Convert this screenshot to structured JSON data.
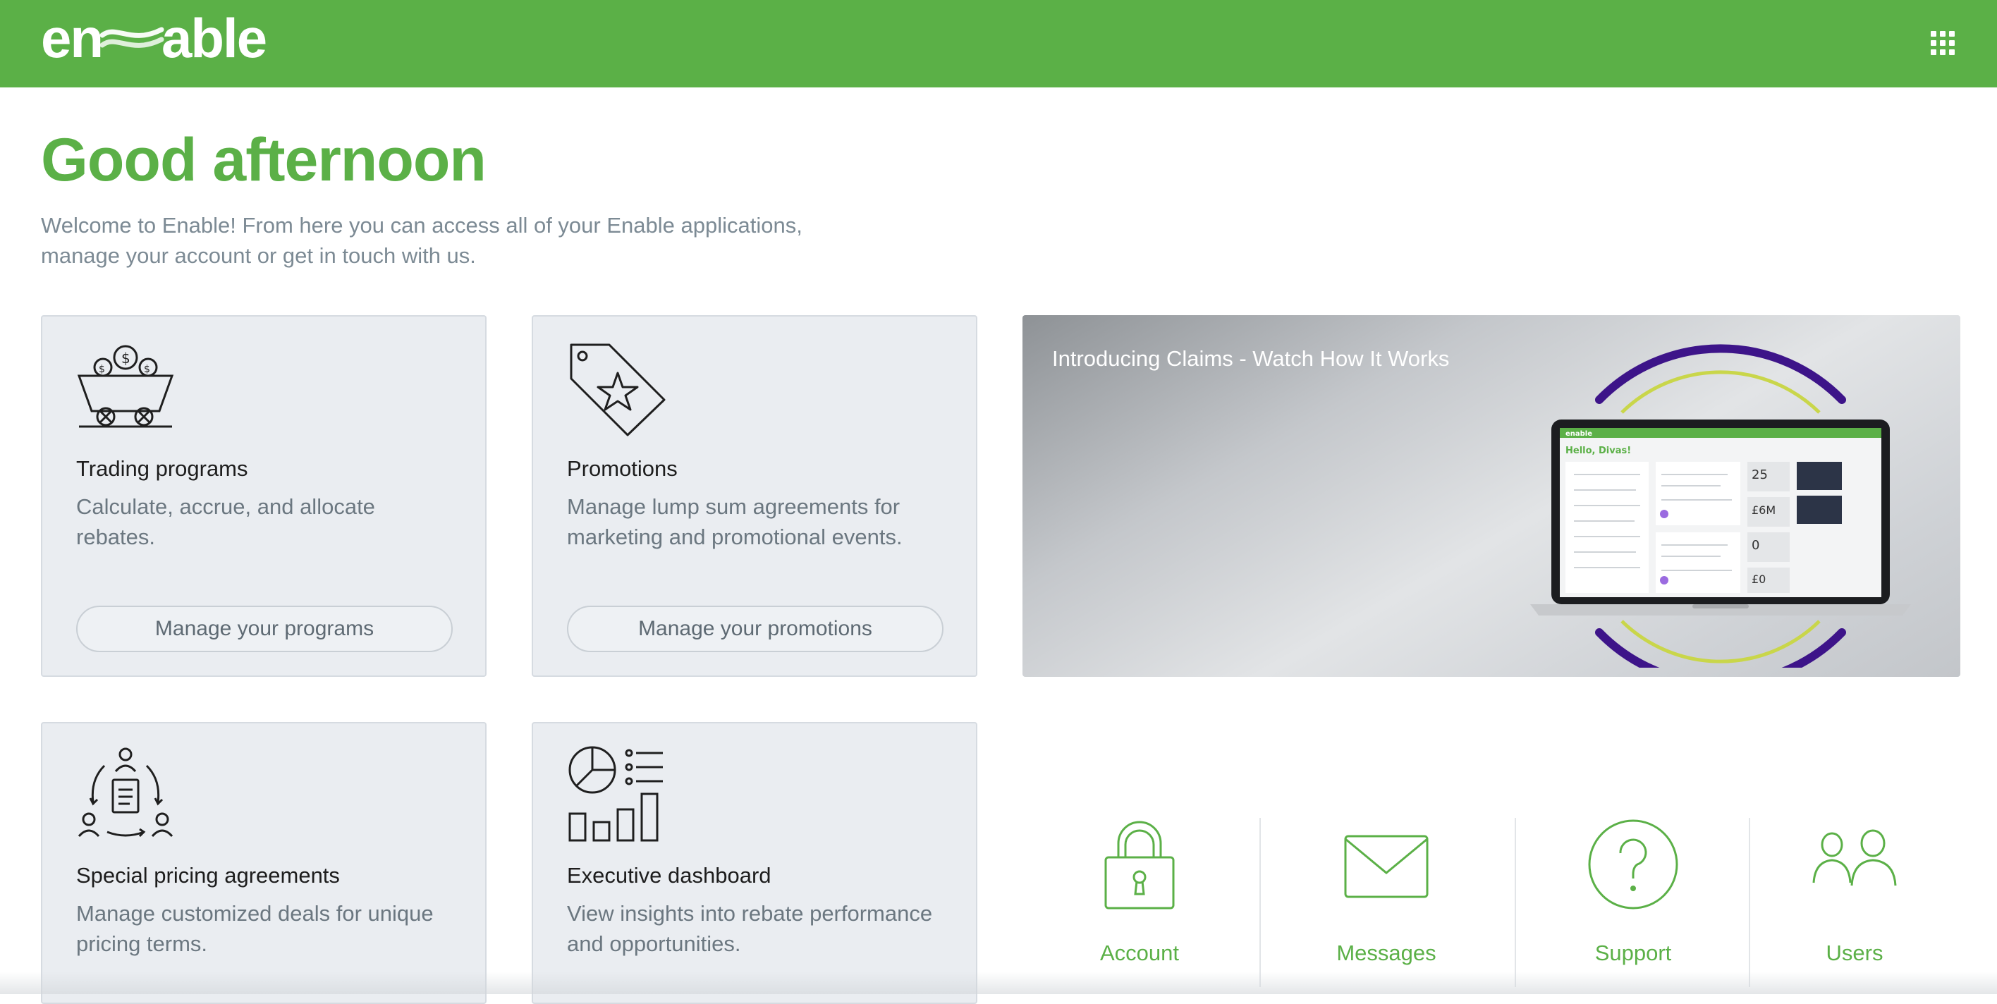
{
  "header": {
    "logo_text_left": "en",
    "logo_text_right": "able",
    "apps_icon": "grid-icon"
  },
  "greeting": "Good afternoon",
  "welcome": "Welcome to Enable! From here you can access all of your Enable applications, manage your account or get in touch with us.",
  "cards": [
    {
      "icon": "mine-cart-coins-icon",
      "title": "Trading programs",
      "description": "Calculate, accrue, and allocate rebates.",
      "button": "Manage your programs"
    },
    {
      "icon": "price-tag-star-icon",
      "title": "Promotions",
      "description": "Manage lump sum agreements for marketing and promotional events.",
      "button": "Manage your promotions"
    },
    {
      "icon": "people-document-cycle-icon",
      "title": "Special pricing agreements",
      "description": "Manage customized deals for unique pricing terms."
    },
    {
      "icon": "chart-dashboard-icon",
      "title": "Executive dashboard",
      "description": "View insights into rebate performance and opportunities."
    }
  ],
  "video": {
    "title": "Introducing Claims - Watch How It Works",
    "screen": {
      "greeting": "Hello, Divas!",
      "stat1": "25",
      "stat2": "£6M",
      "stat3": "0",
      "stat4": "£0"
    }
  },
  "quick_links": [
    {
      "icon": "lock-icon",
      "label": "Account"
    },
    {
      "icon": "envelope-icon",
      "label": "Messages"
    },
    {
      "icon": "question-circle-icon",
      "label": "Support"
    },
    {
      "icon": "users-icon",
      "label": "Users"
    }
  ],
  "colors": {
    "brand_green": "#5bb047",
    "card_bg": "#eaedf1",
    "text_muted": "#7c8a94"
  }
}
